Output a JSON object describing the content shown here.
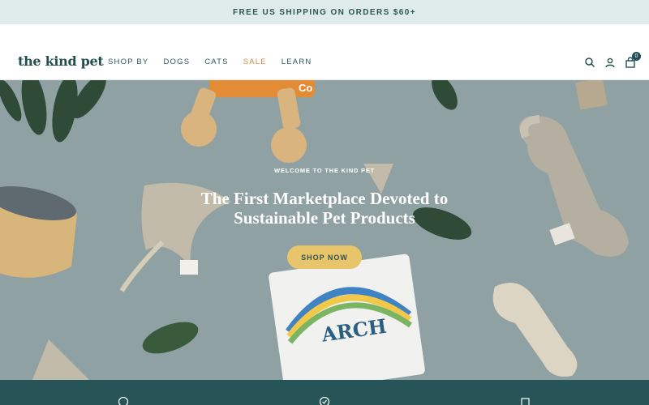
{
  "announcement": {
    "text": "FREE US SHIPPING ON ORDERS $60+"
  },
  "header": {
    "logo": "the kind pet",
    "nav": [
      {
        "label": "SHOP BY"
      },
      {
        "label": "DOGS"
      },
      {
        "label": "CATS"
      },
      {
        "label": "SALE"
      },
      {
        "label": "LEARN"
      }
    ],
    "icons": [
      "search-icon",
      "account-icon",
      "cart-icon"
    ],
    "cart_count": "0"
  },
  "hero": {
    "eyebrow": "WELCOME TO THE KIND PET",
    "headline": "The First Marketplace Devoted to Sustainable Pet Products",
    "cta_label": "SHOP NOW",
    "packaging_text": "ARCH",
    "chew_label": "Co"
  },
  "footerbar": {
    "icons": [
      "paw-icon",
      "check-badge-icon",
      "box-icon"
    ]
  },
  "colors": {
    "announce_bg": "#dfeaea",
    "brand_teal": "#275457",
    "sale_orange": "#d18a3e",
    "cta_yellow": "#e8c46a",
    "hero_bg": "#8fa1a2"
  }
}
